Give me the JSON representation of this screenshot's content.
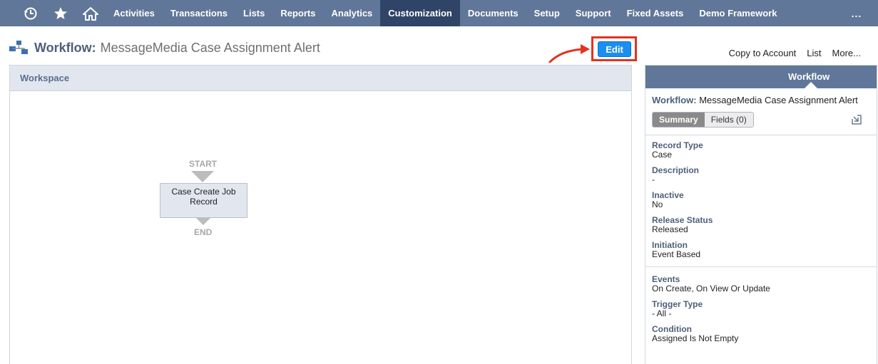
{
  "nav": {
    "items": [
      "Activities",
      "Transactions",
      "Lists",
      "Reports",
      "Analytics",
      "Customization",
      "Documents",
      "Setup",
      "Support",
      "Fixed Assets",
      "Demo Framework"
    ],
    "active": "Customization",
    "more": "...",
    "icons": [
      "recent-history-icon",
      "star-icon",
      "home-icon"
    ]
  },
  "page": {
    "title_label": "Workflow:",
    "title_name": "MessageMedia Case Assignment Alert",
    "edit_label": "Edit",
    "links": [
      "Copy to Account",
      "List",
      "More..."
    ]
  },
  "workspace": {
    "header": "Workspace",
    "start": "START",
    "end": "END",
    "state": "Case Create Job Record"
  },
  "panel": {
    "tab": "Workflow",
    "title_label": "Workflow:",
    "title_name": "MessageMedia Case Assignment Alert",
    "tabs": [
      "Summary",
      "Fields (0)"
    ],
    "fields": [
      {
        "label": "Record Type",
        "value": "Case"
      },
      {
        "label": "Description",
        "value": "-"
      },
      {
        "label": "Inactive",
        "value": "No"
      },
      {
        "label": "Release Status",
        "value": "Released"
      },
      {
        "label": "Initiation",
        "value": "Event Based"
      }
    ],
    "trigger_fields": [
      {
        "label": "Events",
        "value": "On Create, On View Or Update"
      },
      {
        "label": "Trigger Type",
        "value": "- All -"
      },
      {
        "label": "Condition",
        "value": "Assigned Is Not Empty"
      }
    ]
  },
  "colors": {
    "nav_bg": "#607799",
    "nav_active": "#2f4466",
    "edit_button": "#1a8ff0",
    "highlight": "#e5321e"
  }
}
